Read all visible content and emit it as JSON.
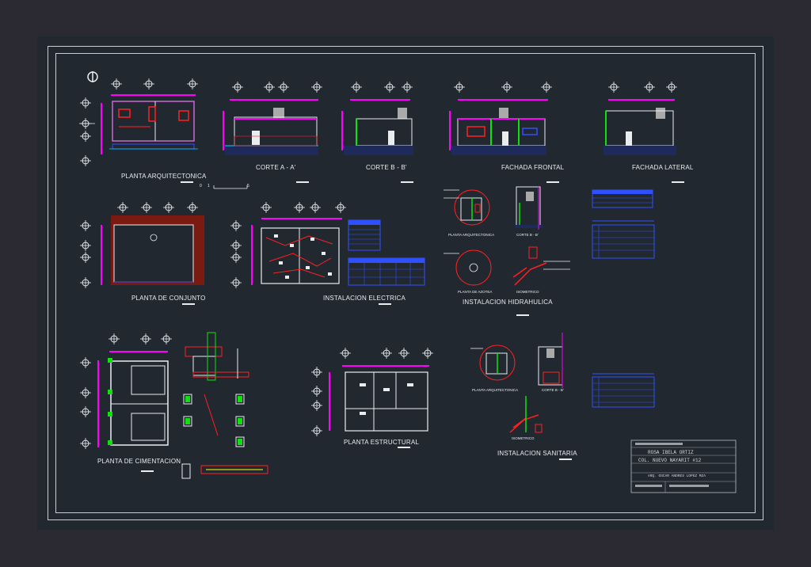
{
  "drawing": {
    "views": {
      "planta_arquitectonica": "PLANTA ARQUITECTONICA",
      "corte_a": "CORTE  A - A'",
      "corte_b": "CORTE  B - B'",
      "fachada_frontal": "FACHADA FRONTAL",
      "fachada_lateral": "FACHADA LATERAL",
      "planta_conjunto": "PLANTA DE CONJUNTO",
      "instalacion_electrica": "INSTALACION ELECTRICA",
      "instalacion_hidraulica": "INSTALACION HIDRAHULICA",
      "planta_cimentacion": "PLANTA DE CIMENTACION",
      "planta_estructural": "PLANTA ESTRUCTURAL",
      "instalacion_sanitaria": "INSTALACION SANITARIA"
    },
    "sublabels": {
      "hid_planta": "PLANTA ARQUITECTONICA",
      "hid_corte": "CORTE B - B'",
      "hid_azotea": "PLANTA DE AZOTEA",
      "hid_isometrico": "ISOMETRICO",
      "san_planta": "PLANTA ARQUITECTONICA",
      "san_corte": "CORTE B - B'",
      "san_isometrico": "ISOMETRICO"
    },
    "scale_bar": {
      "start": "0",
      "mid": "1",
      "end": "5"
    },
    "title_block": {
      "line1": "ROSA IBELA ORTIZ",
      "line2": "COL. NUEVO NAYARIT #12",
      "line3": "ARQ. OSCAR ANDRES LOPEZ MZA"
    },
    "colors": {
      "magenta": "#ff00ff",
      "red": "#ff2020",
      "blue": "#3050ff",
      "cyan": "#00d8ff",
      "yellow": "#ffff00",
      "green": "#10e010",
      "white": "#e9edf0",
      "wall_fill": "#7a1a10"
    }
  }
}
